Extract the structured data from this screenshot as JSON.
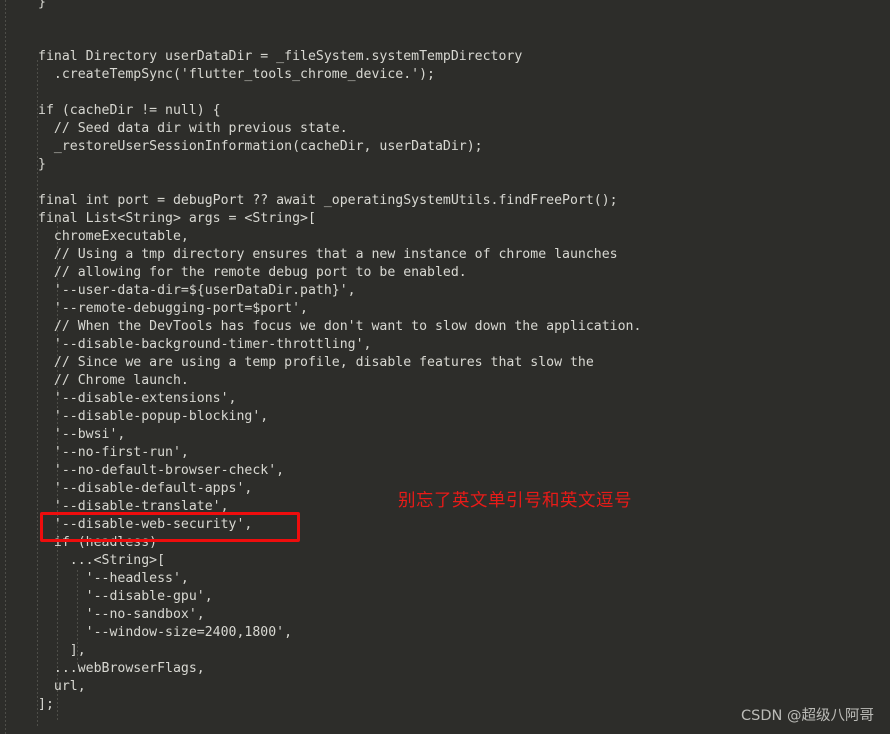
{
  "editor": {
    "background_color": "#2d2d2a",
    "text_color": "#d8d8d2",
    "guide_color": "#4e4e49",
    "font_size_px": 13,
    "line_height_px": 18,
    "language": "dart",
    "lines": [
      "  }",
      "",
      "",
      "  final Directory userDataDir = _fileSystem.systemTempDirectory",
      "    .createTempSync('flutter_tools_chrome_device.');",
      "",
      "  if (cacheDir != null) {",
      "    // Seed data dir with previous state.",
      "    _restoreUserSessionInformation(cacheDir, userDataDir);",
      "  }",
      "",
      "  final int port = debugPort ?? await _operatingSystemUtils.findFreePort();",
      "  final List<String> args = <String>[",
      "    chromeExecutable,",
      "    // Using a tmp directory ensures that a new instance of chrome launches",
      "    // allowing for the remote debug port to be enabled.",
      "    '--user-data-dir=${userDataDir.path}',",
      "    '--remote-debugging-port=$port',",
      "    // When the DevTools has focus we don't want to slow down the application.",
      "    '--disable-background-timer-throttling',",
      "    // Since we are using a temp profile, disable features that slow the",
      "    // Chrome launch.",
      "    '--disable-extensions',",
      "    '--disable-popup-blocking',",
      "    '--bwsi',",
      "    '--no-first-run',",
      "    '--no-default-browser-check',",
      "    '--disable-default-apps',",
      "    '--disable-translate',",
      "    '--disable-web-security',",
      "    if (headless)",
      "      ...<String>[",
      "        '--headless',",
      "        '--disable-gpu',",
      "        '--no-sandbox',",
      "        '--window-size=2400,1800',",
      "      ],",
      "    ...webBrowserFlags,",
      "    url,",
      "  ];"
    ]
  },
  "annotations": {
    "highlight_box": {
      "target_line": "'--disable-web-security',",
      "color": "#ee0d0d",
      "stroke_px": 3
    },
    "note": {
      "text": "别忘了英文单引号和英文逗号",
      "color": "#e81b18"
    }
  },
  "watermark": {
    "text": "CSDN @超级八阿哥",
    "color": "#c8c8c4"
  }
}
